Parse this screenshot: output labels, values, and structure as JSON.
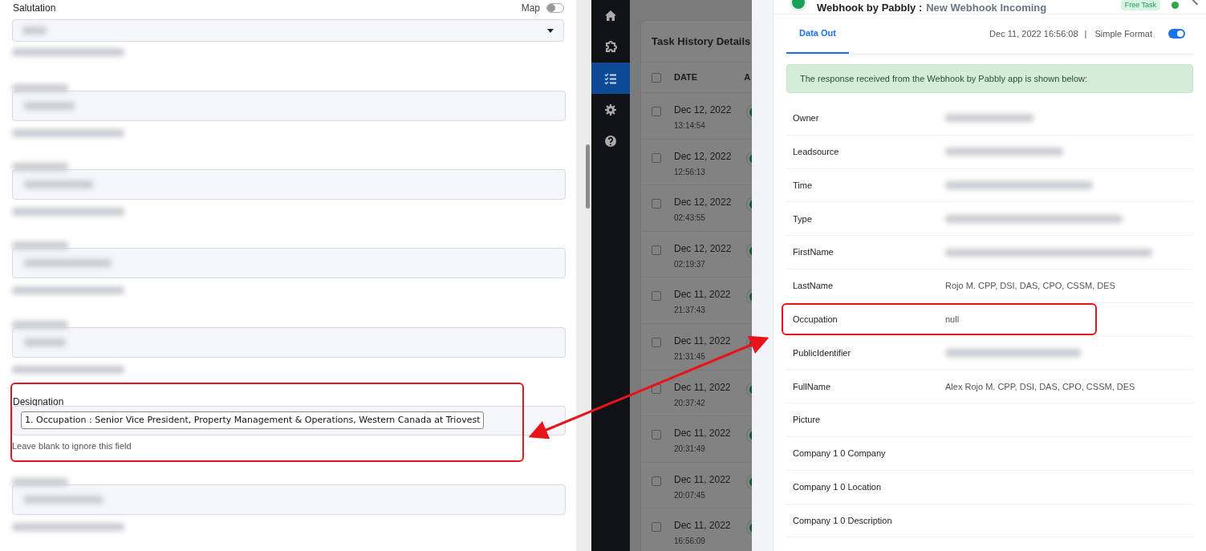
{
  "form": {
    "fields": [
      {
        "kind": "select",
        "label": "Salutation",
        "map_toggle": {
          "label": "Map",
          "on": false
        },
        "highlighted": false
      },
      {
        "kind": "redacted",
        "highlighted": false
      },
      {
        "kind": "redacted",
        "highlighted": false
      },
      {
        "kind": "redacted",
        "highlighted": false
      },
      {
        "kind": "redacted",
        "highlighted": false
      },
      {
        "kind": "tagged",
        "label": "Designation",
        "tag": "1. Occupation : Senior Vice President, Property Management & Operations, Western Canada at Triovest",
        "hint": "Leave blank to ignore this field",
        "highlighted": true
      },
      {
        "kind": "redacted",
        "highlighted": false
      }
    ]
  },
  "sidebar": {
    "items": [
      {
        "selected": false
      },
      {
        "selected": false
      },
      {
        "selected": true
      },
      {
        "selected": false
      },
      {
        "selected": false
      }
    ]
  },
  "task_history": {
    "title": "Task History Details",
    "columns": [
      "DATE",
      "A"
    ],
    "all_checked": false,
    "rows": [
      {
        "date": "Dec 12, 2022",
        "time": "13:14:54",
        "checked": false
      },
      {
        "date": "Dec 12, 2022",
        "time": "12:56:13",
        "checked": false
      },
      {
        "date": "Dec 12, 2022",
        "time": "02:43:55",
        "checked": false
      },
      {
        "date": "Dec 12, 2022",
        "time": "02:19:37",
        "checked": false
      },
      {
        "date": "Dec 11, 2022",
        "time": "21:37:43",
        "checked": false
      },
      {
        "date": "Dec 11, 2022",
        "time": "21:31:45",
        "checked": false
      },
      {
        "date": "Dec 11, 2022",
        "time": "20:37:42",
        "checked": false
      },
      {
        "date": "Dec 11, 2022",
        "time": "20:31:49",
        "checked": false
      },
      {
        "date": "Dec 11, 2022",
        "time": "20:07:45",
        "checked": false
      },
      {
        "date": "Dec 11, 2022",
        "time": "16:56:09",
        "checked": false
      }
    ]
  },
  "detail": {
    "title": "Webhook by Pabbly :",
    "subtitle": "New Webhook Incoming",
    "badge": "Free Task",
    "tabs": [
      {
        "label": "Data Out",
        "selected": true
      }
    ],
    "timestamp": "Dec 11, 2022 16:56:08",
    "separator": "|",
    "format_label": "Simple Format",
    "simple_format_on": true,
    "notice": "The response received from the Webhook by Pabbly app is shown below:",
    "rows": [
      {
        "key": "Owner",
        "redacted": true,
        "highlighted": false
      },
      {
        "key": "Leadsource",
        "redacted": true,
        "highlighted": false
      },
      {
        "key": "Time",
        "redacted": true,
        "highlighted": false
      },
      {
        "key": "Type",
        "redacted": true,
        "highlighted": false
      },
      {
        "key": "FirstName",
        "redacted": true,
        "highlighted": false
      },
      {
        "key": "LastName",
        "value": "Rojo M. CPP, DSI, DAS, CPO, CSSM, DES",
        "redacted": false,
        "highlighted": false
      },
      {
        "key": "Occupation",
        "value": "null",
        "redacted": false,
        "highlighted": true
      },
      {
        "key": "PublicIdentifier",
        "redacted": true,
        "highlighted": false
      },
      {
        "key": "FullName",
        "value": "Alex Rojo M. CPP, DSI, DAS, CPO, CSSM, DES",
        "redacted": false,
        "highlighted": false
      },
      {
        "key": "Picture",
        "redacted": false,
        "highlighted": false
      },
      {
        "key": "Company 1 0 Company",
        "redacted": false,
        "highlighted": false
      },
      {
        "key": "Company 1 0 Location",
        "redacted": false,
        "highlighted": false
      },
      {
        "key": "Company 1 0 Description",
        "redacted": false,
        "highlighted": false
      }
    ]
  }
}
